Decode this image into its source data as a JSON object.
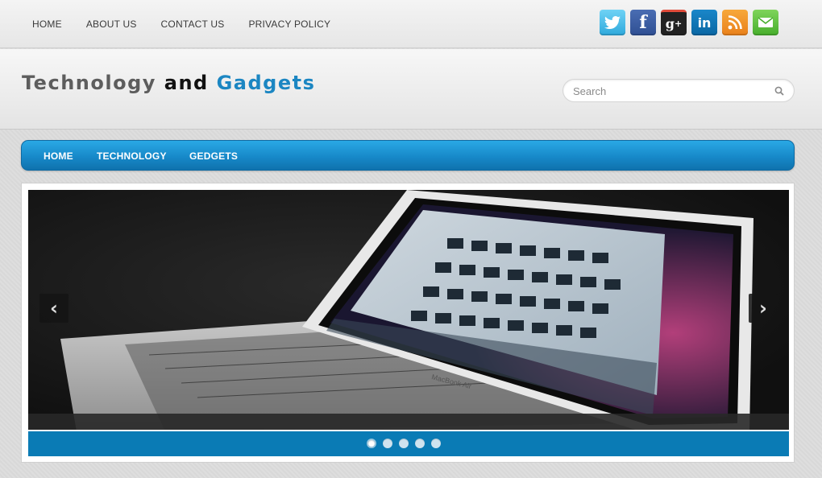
{
  "top_nav": {
    "items": [
      {
        "label": "HOME"
      },
      {
        "label": "ABOUT US"
      },
      {
        "label": "CONTACT US"
      },
      {
        "label": "PRIVACY POLICY"
      }
    ]
  },
  "social": {
    "icons": [
      {
        "name": "twitter-icon",
        "glyph": "t"
      },
      {
        "name": "facebook-icon",
        "glyph": "f"
      },
      {
        "name": "google-plus-icon",
        "glyph": "g+"
      },
      {
        "name": "linkedin-icon",
        "glyph": "in"
      },
      {
        "name": "rss-icon",
        "glyph": "rss"
      },
      {
        "name": "mail-icon",
        "glyph": "mail"
      }
    ]
  },
  "header": {
    "logo": {
      "word1": "Technology",
      "word2": "and",
      "word3": "Gadgets"
    },
    "search_placeholder": "Search"
  },
  "main_nav": {
    "items": [
      {
        "label": "HOME"
      },
      {
        "label": "TECHNOLOGY"
      },
      {
        "label": "GEDGETS"
      }
    ]
  },
  "slider": {
    "image_subject": "MacBook Air laptop",
    "laptop_label": "MacBook Air",
    "prev_glyph": "‹",
    "next_glyph": "›",
    "slide_count": 5,
    "active_slide": 1
  },
  "colors": {
    "brand_blue": "#1b86c2",
    "nav_blue": "#1789c9",
    "pager_blue": "#0a7bb5"
  }
}
